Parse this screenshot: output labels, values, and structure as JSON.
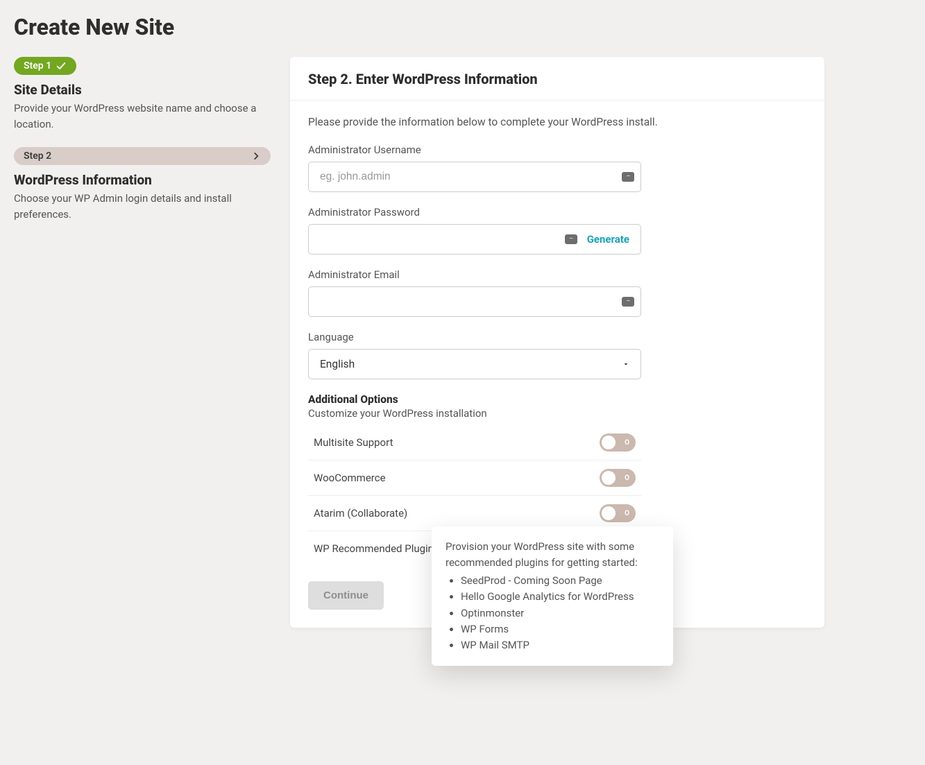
{
  "page": {
    "title": "Create New Site"
  },
  "sidebar": {
    "step1": {
      "pill": "Step 1",
      "title": "Site Details",
      "desc": "Provide your WordPress website name and choose a location."
    },
    "step2": {
      "pill": "Step 2",
      "title": "WordPress Information",
      "desc": "Choose your WP Admin login details and install preferences."
    }
  },
  "card": {
    "header": "Step 2. Enter WordPress Information",
    "intro": "Please provide the information below to complete your WordPress install.",
    "fields": {
      "username": {
        "label": "Administrator Username",
        "placeholder": "eg. john.admin",
        "value": ""
      },
      "password": {
        "label": "Administrator Password",
        "value": "",
        "generate": "Generate"
      },
      "email": {
        "label": "Administrator Email",
        "value": ""
      },
      "language": {
        "label": "Language",
        "value": "English"
      }
    },
    "additional": {
      "title": "Additional Options",
      "sub": "Customize your WordPress installation",
      "options": [
        {
          "label": "Multisite Support",
          "on": false
        },
        {
          "label": "WooCommerce",
          "on": false
        },
        {
          "label": "Atarim (Collaborate)",
          "on": false
        },
        {
          "label": "WP Recommended Plugins",
          "on": true,
          "help": true
        }
      ]
    },
    "continue": "Continue"
  },
  "tooltip": {
    "text": "Provision your WordPress site with some recommended plugins for getting started:",
    "items": [
      "SeedProd - Coming Soon Page",
      "Hello Google Analytics for WordPress",
      "Optinmonster",
      "WP Forms",
      "WP Mail SMTP"
    ]
  }
}
